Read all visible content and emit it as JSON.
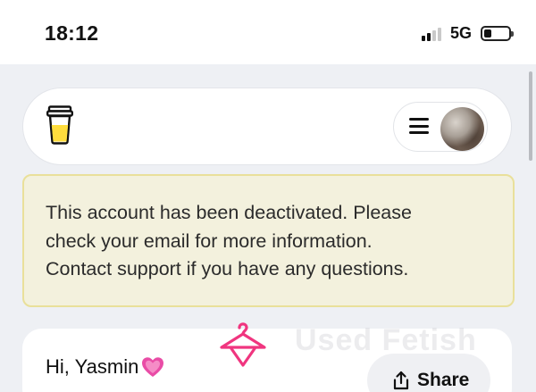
{
  "status_bar": {
    "time": "18:12",
    "network": "5G",
    "signal_level": 2,
    "battery_level": 0.2
  },
  "nav": {
    "logo_icon": "coffee-cup-icon",
    "menu_icon": "hamburger-menu-icon",
    "avatar_icon": "user-avatar"
  },
  "alert": {
    "lines": [
      "This account has been deactivated. Please",
      "check your email for more information.",
      "Contact support if you have any questions."
    ]
  },
  "profile_card": {
    "greeting": "Hi, Yasmin",
    "greeting_emoji": "heart-icon",
    "share_label": "Share",
    "share_icon": "share-upload-icon"
  },
  "watermark": {
    "icon": "hanger-icon",
    "text": "Used Fetish"
  },
  "colors": {
    "page_background": "#eef0f4",
    "alert_background": "#f3f1dd",
    "alert_border": "#e9e09a",
    "logo_yellow": "#ffdd3d",
    "heart_pink": "#e94ca6",
    "watermark_pink": "#f0357f"
  }
}
